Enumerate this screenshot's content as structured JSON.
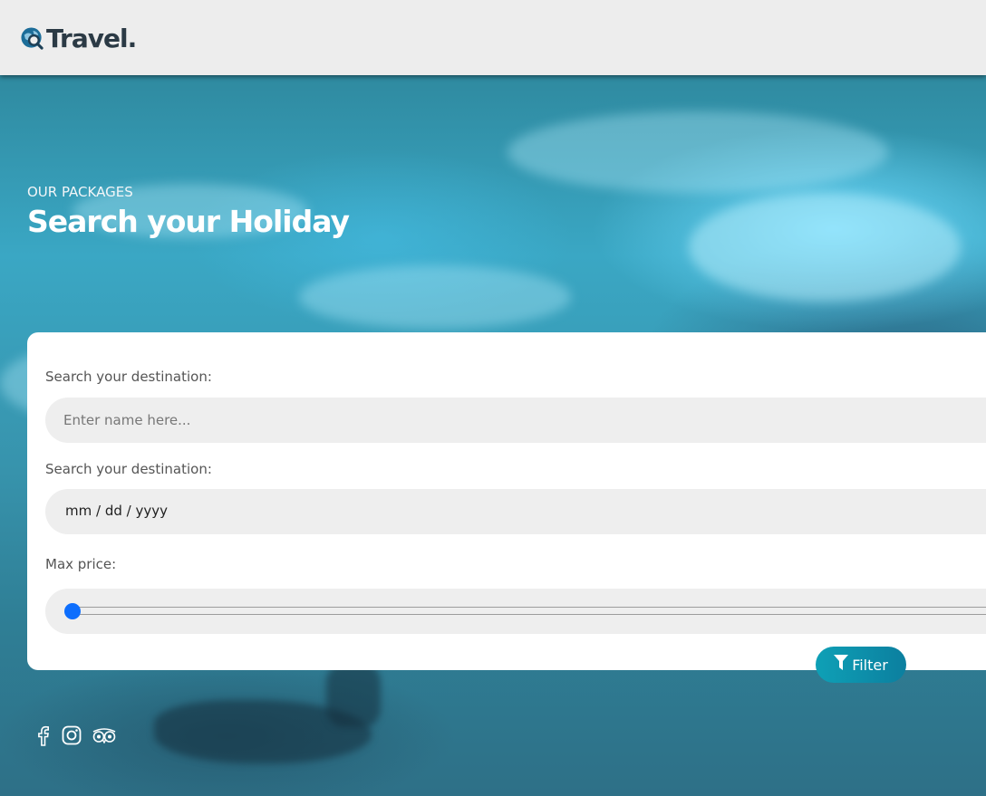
{
  "header": {
    "brand_name": "Travel.",
    "logo_icon": "globe-search-icon"
  },
  "hero": {
    "eyebrow": "OUR PACKAGES",
    "title": "Search your Holiday"
  },
  "search_form": {
    "destination_label": "Search your destination:",
    "destination_placeholder": "Enter name here...",
    "date_label": "Search your destination:",
    "date_value": "mm / dd / yyyy",
    "price_label": "Max price:",
    "price_slider_value_fraction": 0.0,
    "filter_button_label": "Filter",
    "filter_icon": "funnel-icon",
    "accent_color": "#0d6efd",
    "button_color": "#0e9bb5"
  },
  "social": {
    "icons": [
      "facebook-icon",
      "instagram-icon",
      "tripadvisor-icon"
    ]
  }
}
